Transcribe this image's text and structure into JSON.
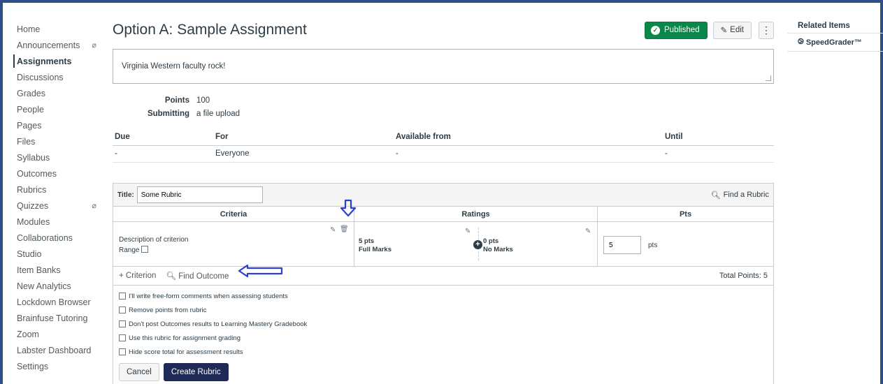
{
  "sidebar": {
    "items": [
      {
        "label": "Home"
      },
      {
        "label": "Announcements",
        "hidden_icon": "⌀"
      },
      {
        "label": "Assignments",
        "active": true
      },
      {
        "label": "Discussions"
      },
      {
        "label": "Grades"
      },
      {
        "label": "People"
      },
      {
        "label": "Pages"
      },
      {
        "label": "Files"
      },
      {
        "label": "Syllabus"
      },
      {
        "label": "Outcomes"
      },
      {
        "label": "Rubrics"
      },
      {
        "label": "Quizzes",
        "hidden_icon": "⌀"
      },
      {
        "label": "Modules"
      },
      {
        "label": "Collaborations"
      },
      {
        "label": "Studio"
      },
      {
        "label": "Item Banks"
      },
      {
        "label": "New Analytics"
      },
      {
        "label": "Lockdown Browser"
      },
      {
        "label": "Brainfuse Tutoring"
      },
      {
        "label": "Zoom"
      },
      {
        "label": "Labster Dashboard"
      },
      {
        "label": "Settings"
      }
    ]
  },
  "header": {
    "title": "Option A: Sample Assignment",
    "published_label": "Published",
    "edit_label": "Edit",
    "more_icon": "⋮"
  },
  "description": "Virginia Western faculty rock!",
  "details": {
    "points_label": "Points",
    "points_value": "100",
    "submitting_label": "Submitting",
    "submitting_value": "a file upload"
  },
  "dates": {
    "headers": [
      "Due",
      "For",
      "Available from",
      "Until"
    ],
    "row": [
      "-",
      "Everyone",
      "-",
      "-"
    ]
  },
  "rubric": {
    "title_label": "Title:",
    "title_value": "Some Rubric",
    "find_rubric": "Find a Rubric",
    "col_criteria": "Criteria",
    "col_ratings": "Ratings",
    "col_pts": "Pts",
    "criterion": {
      "description": "Description of criterion",
      "range_label": "Range"
    },
    "ratings": [
      {
        "pts": "5 pts",
        "label": "Full Marks"
      },
      {
        "pts": "0 pts",
        "label": "No Marks"
      }
    ],
    "pts_value": "5",
    "pts_unit": "pts",
    "add_criterion": "+ Criterion",
    "find_outcome": "Find Outcome",
    "total_points": "Total Points: 5",
    "options": [
      "I'll write free-form comments when assessing students",
      "Remove points from rubric",
      "Don't post Outcomes results to Learning Mastery Gradebook",
      "Use this rubric for assignment grading",
      "Hide score total for assessment results"
    ],
    "cancel_label": "Cancel",
    "create_label": "Create Rubric"
  },
  "aside": {
    "title": "Related Items",
    "speedgrader": "SpeedGrader™"
  },
  "colors": {
    "published_green": "#0b874b",
    "create_navy": "#1f2a56",
    "annotation_blue": "#2b3fd1",
    "frame_blue": "#2b4f86"
  }
}
